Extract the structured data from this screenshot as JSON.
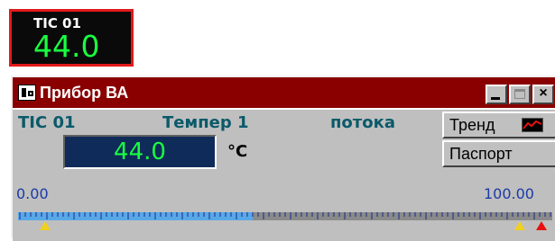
{
  "tile": {
    "name": "TIC 01",
    "value": "44.0"
  },
  "window": {
    "title": "Прибор ВА",
    "controls": {
      "minimize": "",
      "maximize": "",
      "close": "×"
    }
  },
  "panel": {
    "tag": "TIC 01",
    "description": "Темпер 1",
    "description2": "потока",
    "value": "44.0",
    "unit": "°C",
    "buttons": {
      "trend": "Тренд",
      "passport": "Паспорт"
    },
    "scale": {
      "min_label": "0.00",
      "max_label": "100.00",
      "fill_fraction": 0.44
    }
  },
  "colors": {
    "tile_border": "#e31a1a",
    "value_green": "#19ff40",
    "title_bar": "#8a0000",
    "value_box": "#0f2b5a",
    "scale_fill": "#58a8e8"
  }
}
